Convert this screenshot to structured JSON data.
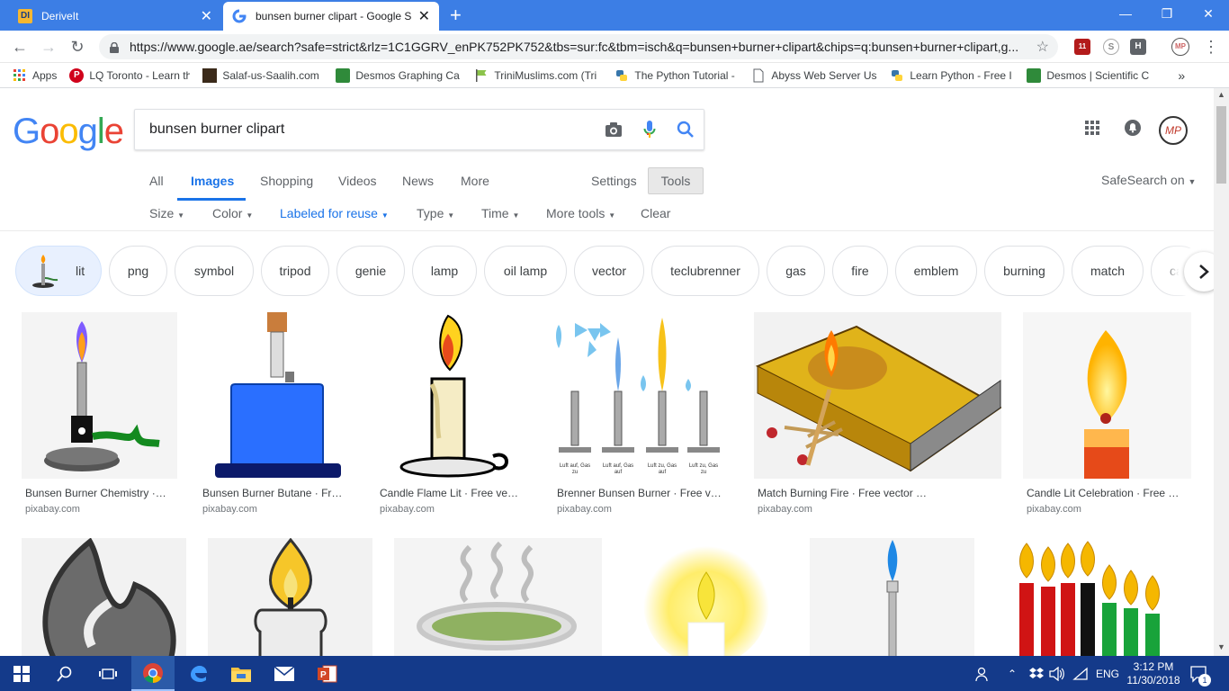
{
  "browser": {
    "tabs": [
      {
        "title": "DeriveIt"
      },
      {
        "title": "bunsen burner clipart - Google S"
      }
    ],
    "url": "https://www.google.ae/search?safe=strict&rlz=1C1GGRV_enPK752PK752&tbs=sur:fc&tbm=isch&q=bunsen+burner+clipart&chips=q:bunsen+burner+clipart,g...",
    "ext_badge": "11",
    "ext_h": "H",
    "bookmarks": [
      {
        "label": "Apps"
      },
      {
        "label": "LQ Toronto - Learn th"
      },
      {
        "label": "Salaf-us-Saalih.com |"
      },
      {
        "label": "Desmos Graphing Ca"
      },
      {
        "label": "TriniMuslims.com (Tri"
      },
      {
        "label": "The Python Tutorial -"
      },
      {
        "label": "Abyss Web Server Us"
      },
      {
        "label": "Learn Python - Free I"
      },
      {
        "label": "Desmos | Scientific C"
      }
    ],
    "bookmarks_more": "»"
  },
  "google": {
    "logo": "Google",
    "query": "bunsen burner clipart",
    "avatar_initials": "MP",
    "nav": {
      "all": "All",
      "images": "Images",
      "shopping": "Shopping",
      "videos": "Videos",
      "news": "News",
      "more": "More",
      "settings": "Settings",
      "tools": "Tools",
      "safesearch": "SafeSearch on"
    },
    "filters": {
      "size": "Size",
      "color": "Color",
      "rights": "Labeled for reuse",
      "type": "Type",
      "time": "Time",
      "more_tools": "More tools",
      "clear": "Clear"
    },
    "chips": [
      "lit",
      "png",
      "symbol",
      "tripod",
      "genie",
      "lamp",
      "oil lamp",
      "vector",
      "teclubrenner",
      "gas",
      "fire",
      "emblem",
      "burning",
      "match",
      "ca"
    ],
    "results_row1": [
      {
        "caption": "Bunsen Burner Chemistry ·…",
        "source": "pixabay.com"
      },
      {
        "caption": "Bunsen Burner Butane · Fr…",
        "source": "pixabay.com"
      },
      {
        "caption": "Candle Flame Lit · Free ve…",
        "source": "pixabay.com"
      },
      {
        "caption": "Brenner Bunsen Burner · Free v…",
        "source": "pixabay.com"
      },
      {
        "caption": "Match Burning Fire · Free vector …",
        "source": "pixabay.com"
      },
      {
        "caption": "Candle Lit Celebration · Free …",
        "source": "pixabay.com"
      }
    ],
    "brenner_labels": [
      "Luft auf, Gas zu",
      "Luft auf, Gas auf",
      "Luft zu, Gas auf",
      "Luft zu, Gas zu"
    ]
  },
  "taskbar": {
    "lang": "ENG",
    "time": "3:12 PM",
    "date": "11/30/2018",
    "notif_count": "1"
  },
  "colors": {
    "tabstrip": "#3c7ee5",
    "google_blue": "#1a73e8",
    "taskbar": "#143a8a"
  }
}
